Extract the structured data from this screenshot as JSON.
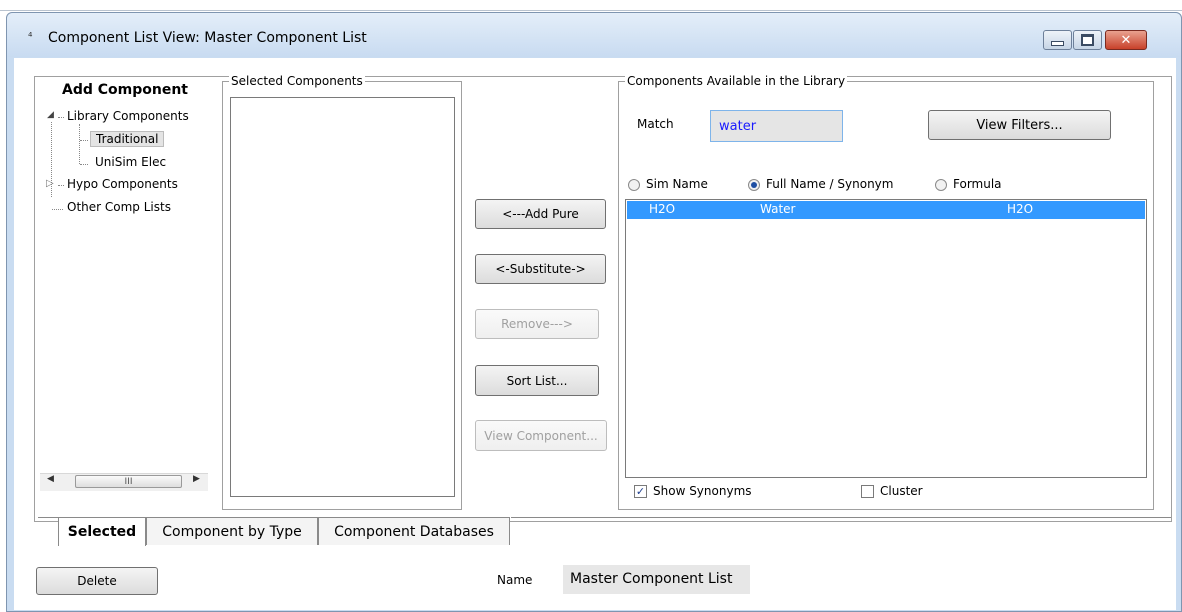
{
  "window": {
    "title": "Component List View: Master Component List",
    "icon": "app-icon",
    "close_label": "✕"
  },
  "add_component": {
    "heading": "Add Component",
    "tree": [
      {
        "label": "Library Components",
        "expanded": true
      },
      {
        "label": "Traditional",
        "selected": true
      },
      {
        "label": "UniSim Elec"
      },
      {
        "label": "Hypo Components",
        "expanded": false
      },
      {
        "label": "Other Comp Lists"
      }
    ],
    "scroll_thumb_label": "III"
  },
  "selected_components": {
    "label": "Selected Components",
    "items": []
  },
  "actions": {
    "add_pure": "<---Add Pure",
    "substitute": "<-Substitute->",
    "remove": "Remove--->",
    "sort_list": "Sort List...",
    "view_component": "View Component..."
  },
  "library": {
    "label": "Components Available in the Library",
    "match_label": "Match",
    "match_value": "water",
    "view_filters": "View Filters...",
    "radios": [
      {
        "label": "Sim Name",
        "checked": false
      },
      {
        "label": "Full Name / Synonym",
        "checked": true
      },
      {
        "label": "Formula",
        "checked": false
      }
    ],
    "rows": [
      {
        "sim_name": "H2O",
        "full_name": "Water",
        "formula": "H2O",
        "selected": true
      }
    ],
    "show_synonyms": {
      "label": "Show Synonyms",
      "checked": true
    },
    "cluster": {
      "label": "Cluster",
      "checked": false
    }
  },
  "tabs": [
    {
      "label": "Selected",
      "active": true
    },
    {
      "label": "Component by Type",
      "active": false
    },
    {
      "label": "Component Databases",
      "active": false
    }
  ],
  "footer": {
    "delete_label": "Delete",
    "name_label": "Name",
    "name_value": "Master Component List"
  },
  "colors": {
    "selection": "#3399ff",
    "title_bar": "#c8dbf1",
    "match_text": "#1a1aff"
  }
}
